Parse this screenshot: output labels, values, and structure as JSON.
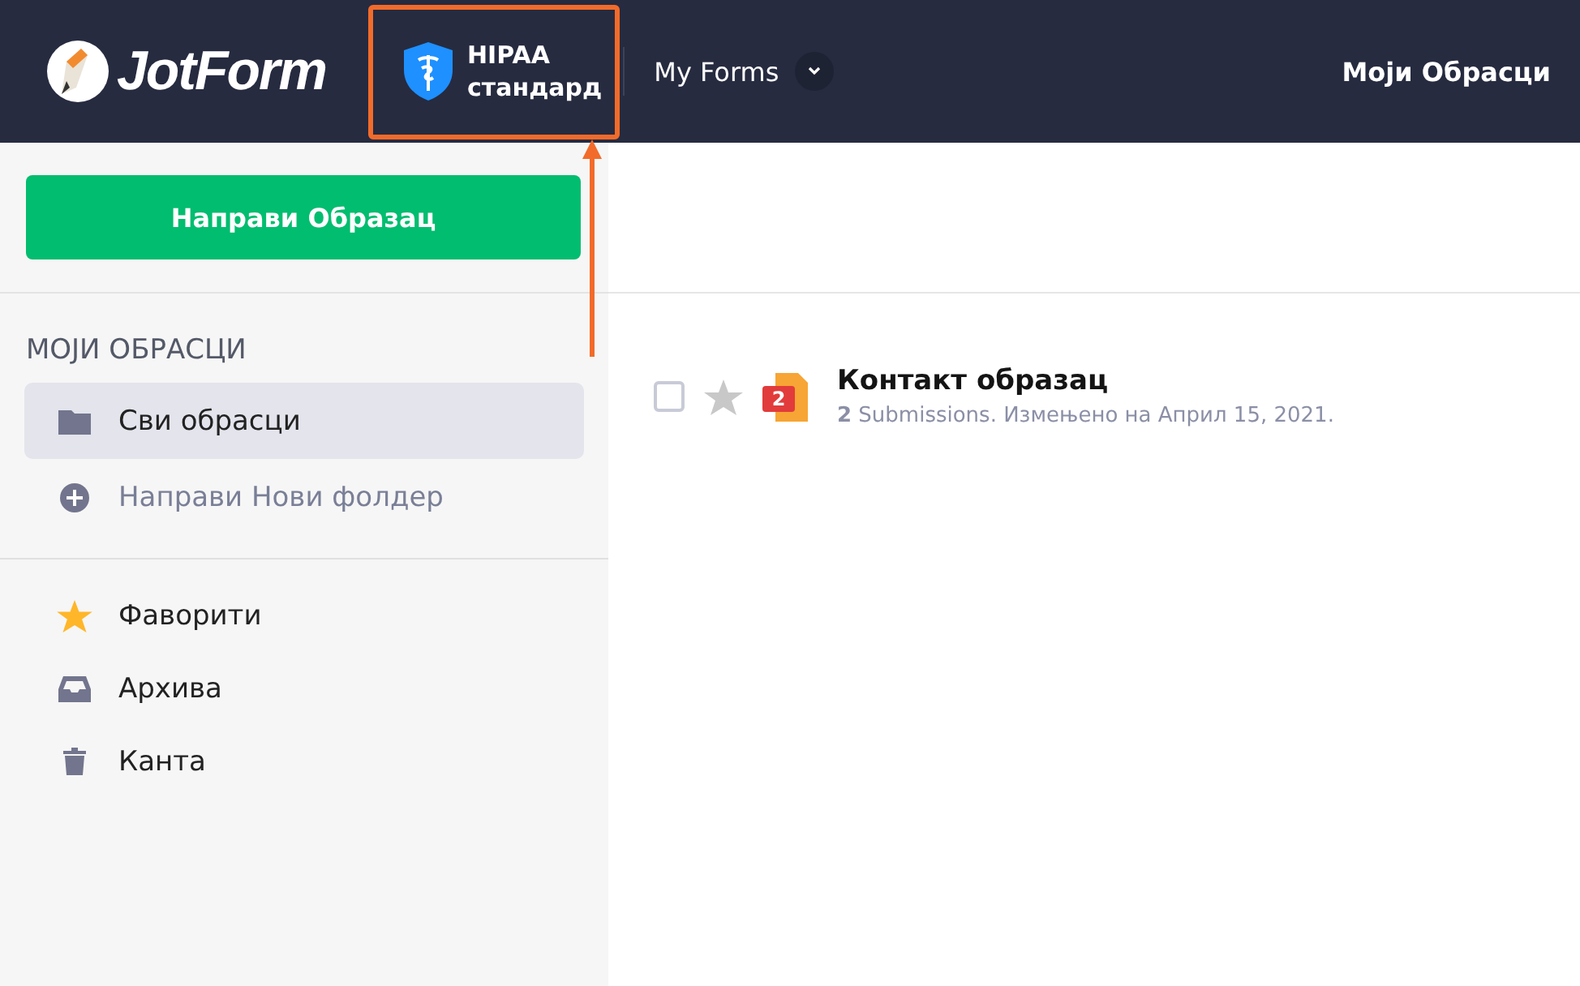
{
  "header": {
    "logo": "JotForm",
    "badge_lines": [
      "HIPAA",
      "стандард"
    ],
    "nav": "My Forms",
    "right_link": "Моји Обрасци",
    "highlighted": true
  },
  "sidebar": {
    "create_button": "Направи Образац",
    "section_title": "МОЈИ ОБРАСЦИ",
    "folders": [
      {
        "label": "Сви обрасци",
        "kind": "folder",
        "selected": true
      },
      {
        "label": "Направи Нови фолдер",
        "kind": "plus",
        "selected": false
      }
    ],
    "items": [
      {
        "label": "Фаворити",
        "kind": "star",
        "selected": false
      },
      {
        "label": "Архива",
        "kind": "inbox",
        "selected": false
      },
      {
        "label": "Канта",
        "kind": "trash",
        "selected": false
      }
    ]
  },
  "forms": [
    {
      "title": "Контакт образац",
      "meta": "**2** Submissions. Измењено на Април 15, 2021.",
      "badge": "2",
      "checked": false,
      "starred": false
    }
  ]
}
